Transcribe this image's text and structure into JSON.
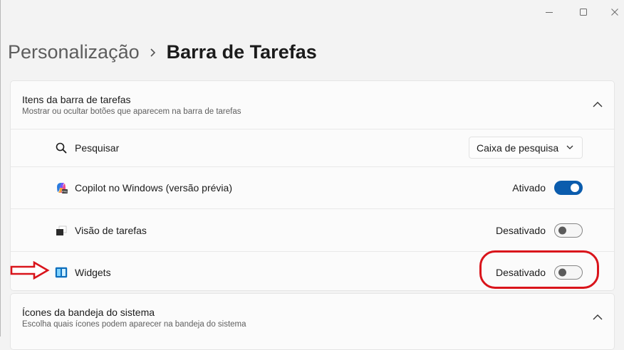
{
  "window": {
    "minimize_icon": "minimize-icon",
    "maximize_icon": "maximize-icon",
    "close_icon": "close-icon"
  },
  "breadcrumb": {
    "parent": "Personalização",
    "current": "Barra de Tarefas"
  },
  "taskbar_items": {
    "title": "Itens da barra de tarefas",
    "subtitle": "Mostrar ou ocultar botões que aparecem na barra de tarefas",
    "expanded": true,
    "items": [
      {
        "label": "Pesquisar",
        "icon": "search-icon",
        "control": "dropdown",
        "value": "Caixa de pesquisa"
      },
      {
        "label": "Copilot no Windows (versão prévia)",
        "icon": "copilot-icon",
        "control": "toggle",
        "status": "Ativado",
        "on": true
      },
      {
        "label": "Visão de tarefas",
        "icon": "task-view-icon",
        "control": "toggle",
        "status": "Desativado",
        "on": false
      },
      {
        "label": "Widgets",
        "icon": "widgets-icon",
        "control": "toggle",
        "status": "Desativado",
        "on": false
      }
    ]
  },
  "system_tray": {
    "title": "Ícones da bandeja do sistema",
    "subtitle": "Escolha quais ícones podem aparecer na bandeja do sistema"
  },
  "annotations": {
    "arrow_color": "#d9141b",
    "highlight_color": "#d9141b"
  },
  "colors": {
    "accent": "#0b5cad",
    "background": "#f3f3f3",
    "card": "#fbfbfb"
  }
}
